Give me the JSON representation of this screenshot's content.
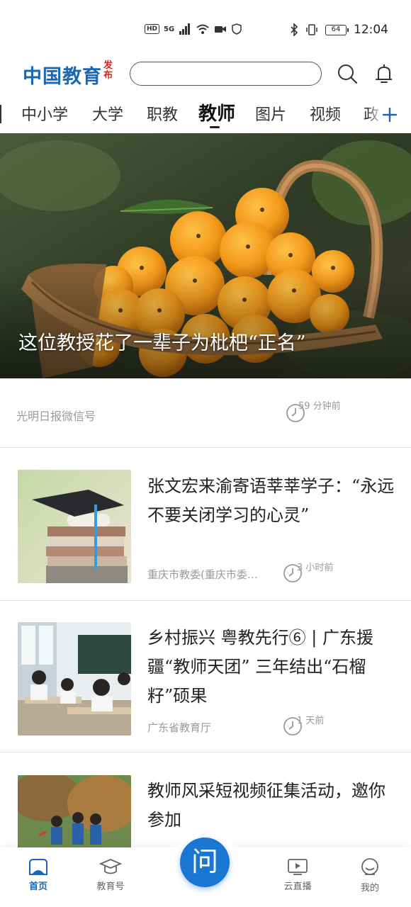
{
  "status_bar": {
    "left_badges": [
      "HD",
      "5G"
    ],
    "battery": "64",
    "time": "12:04"
  },
  "header": {
    "logo_main": "中国教育",
    "logo_sub": "发布",
    "search_placeholder": "",
    "icons": [
      "search-icon",
      "bell-icon"
    ]
  },
  "tabs": [
    {
      "label": "中小学"
    },
    {
      "label": "大学"
    },
    {
      "label": "职教"
    },
    {
      "label": "教师",
      "active": true
    },
    {
      "label": "图片"
    },
    {
      "label": "视频"
    },
    {
      "label": "政"
    }
  ],
  "hero": {
    "title": "这位教授花了一辈子为枇杷“正名”",
    "source": "光明日报微信号",
    "time": "59 分钟前"
  },
  "articles": [
    {
      "title": "张文宏来渝寄语莘莘学子：“永远不要关闭学习的心灵”",
      "source": "重庆市教委(重庆市委…",
      "time": "3 小时前"
    },
    {
      "title": "乡村振兴 粤教先行⑥ | 广东援疆“教师天团” 三年结出“石榴籽”硕果",
      "source": "广东省教育厅",
      "time": "1 天前"
    },
    {
      "title": "教师风采短视频征集活动，邀你参加"
    }
  ],
  "bottom_nav": {
    "items": [
      {
        "label": "首页",
        "icon": "home-icon",
        "active": true
      },
      {
        "label": "教育号",
        "icon": "graduation-cap-icon"
      },
      {
        "label": "云直播",
        "icon": "live-video-icon"
      },
      {
        "label": "我的",
        "icon": "profile-icon"
      }
    ],
    "ask_label": "问"
  },
  "colors": {
    "brand_blue": "#1c67b3",
    "brand_red": "#d8241b",
    "ask_button": "#1976d2"
  }
}
